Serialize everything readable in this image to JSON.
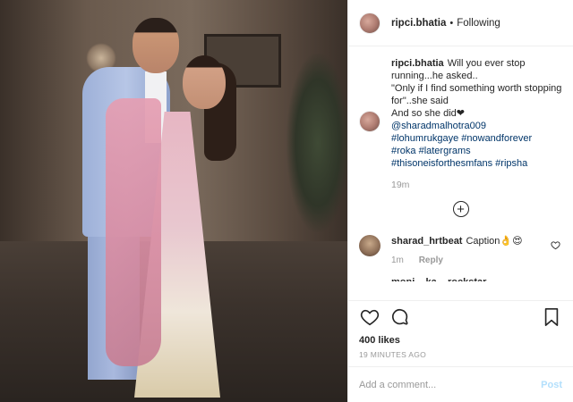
{
  "header": {
    "username": "ripci.bhatia",
    "separator": "•",
    "follow_status": "Following"
  },
  "caption": {
    "username": "ripci.bhatia",
    "lines": [
      "Will you ever stop running...he asked..",
      "\"Only if I find something worth stopping for\"..she said",
      "And so she did❤"
    ],
    "mention": "@sharadmalhotra009",
    "hashtags": [
      "#lohumrukgaye #nowandforever",
      "#roka #latergrams",
      "#thisoneisforthesmfans #ripsha"
    ],
    "time": "19m"
  },
  "load_more": {
    "icon": "plus-circle-icon",
    "glyph": "+"
  },
  "comments": [
    {
      "username": "sharad_hrtbeat",
      "text": "Caption👌😍",
      "time": "1m",
      "reply_label": "Reply"
    }
  ],
  "truncated_comment": "moni__ka__rockstar",
  "actions": {
    "like_icon": "heart-icon",
    "comment_icon": "comment-icon",
    "save_icon": "bookmark-icon"
  },
  "likes": "400 likes",
  "timestamp": "19 MINUTES AGO",
  "add_comment": {
    "placeholder": "Add a comment...",
    "post_label": "Post"
  },
  "colors": {
    "link": "#003569",
    "muted": "#999999",
    "post_disabled": "#b2dffc",
    "border": "#efefef"
  }
}
